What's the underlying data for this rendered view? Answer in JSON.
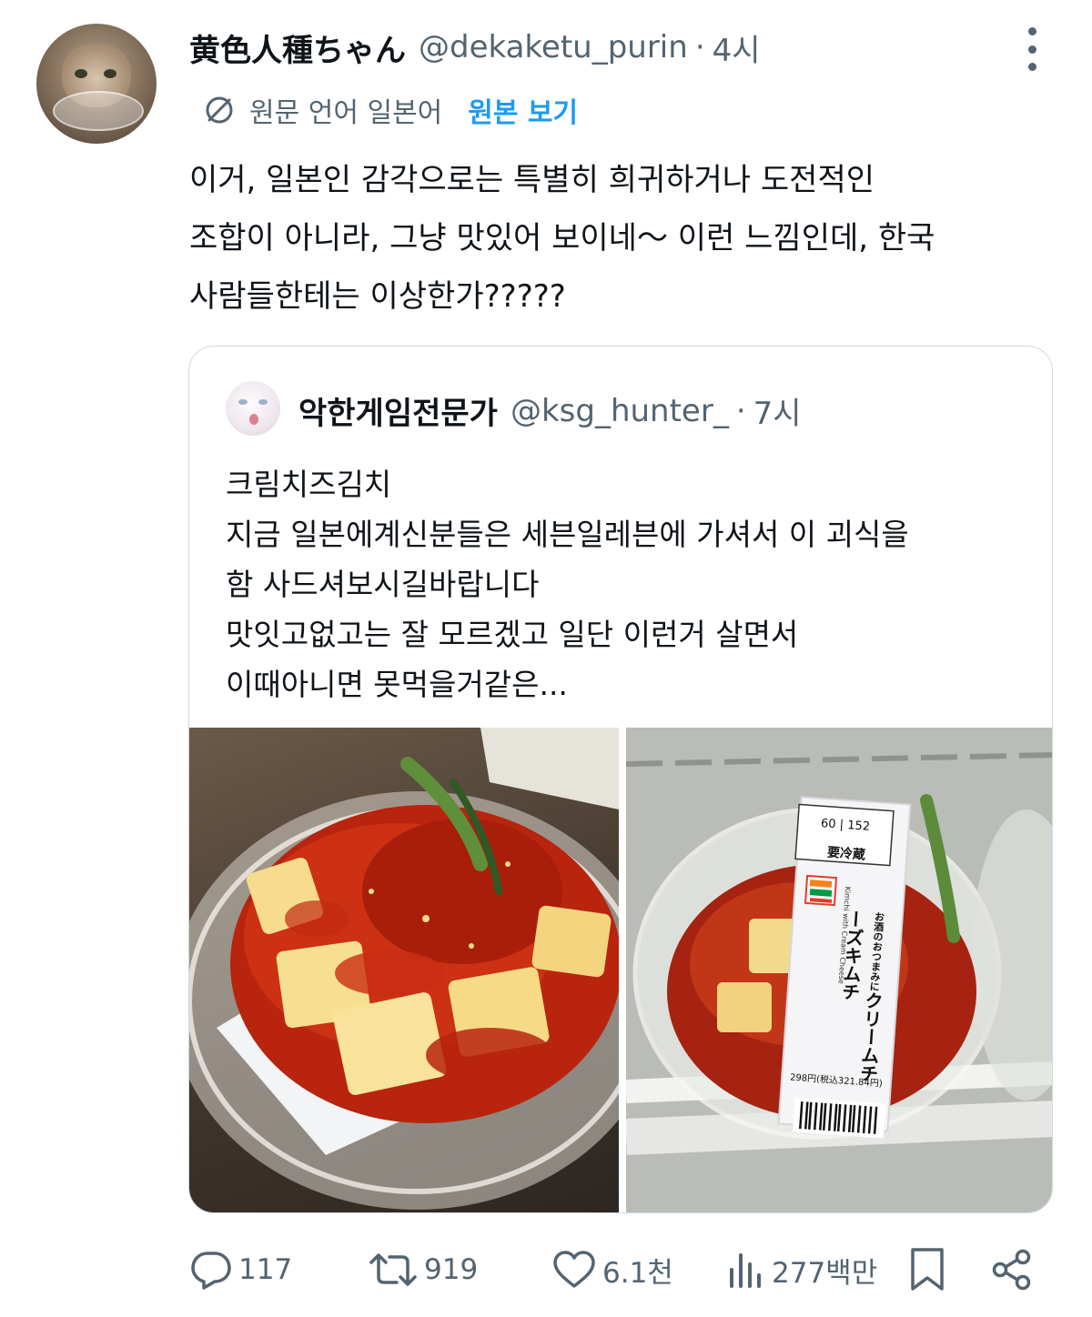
{
  "tweet": {
    "author_name": "黄色人種ちゃん",
    "author_handle": "@dekaketu_purin",
    "separator": "·",
    "time": "4시",
    "translate": {
      "label": "원문 언어 일본어",
      "link": "원본 보기"
    },
    "text_lines": [
      "이거, 일본인 감각으로는 특별히 희귀하거나 도전적인",
      "조합이 아니라, 그냥 맛있어 보이네〜 이런 느낌인데, 한국",
      "사람들한테는 이상한가?????"
    ]
  },
  "quote": {
    "author_name": "악한게임전문가",
    "author_handle": "@ksg_hunter_",
    "separator": "·",
    "time": "7시",
    "text_lines": [
      "크림치즈김치",
      "지금 일본에계신분들은 세븐일레븐에 가셔서 이 괴식을",
      "함 사드셔보시길바랍니다",
      "맛잇고없고는 잘 모르겠고 일단 이런거 살면서",
      "이때아니면 못먹을거같은..."
    ],
    "images": [
      {
        "icon": "kimchi-cream-cheese-photo"
      },
      {
        "icon": "seven-eleven-package-photo",
        "package_text": {
          "lid_top": "要冷蔵",
          "title_line1": "お酒のおつまみに",
          "title_line2": "クリームチーズ",
          "title_line3": "キムチ",
          "english": "Kimchi with Cream Cheese",
          "price": "298円(税込321.84円)",
          "nutrition_1": "60",
          "nutrition_2": "152"
        }
      }
    ]
  },
  "actions": {
    "reply_count": "117",
    "retweet_count": "919",
    "like_count": "6.1천",
    "views_count": "277백만"
  },
  "colors": {
    "text": "#0f1419",
    "secondary": "#536471",
    "link": "#1d9bf0",
    "border": "#cfd9de"
  }
}
